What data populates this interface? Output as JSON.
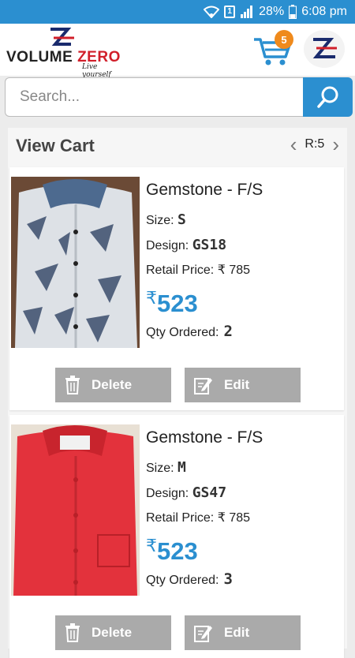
{
  "status": {
    "battery": "28%",
    "time": "6:08 pm",
    "sim": "1"
  },
  "header": {
    "logo_text_a": "VOLUME ",
    "logo_text_z": "ZERO",
    "tagline": "Live yourself",
    "cart_count": "5"
  },
  "search": {
    "placeholder": "Search..."
  },
  "cart": {
    "title": "View Cart",
    "record_label": "R:5",
    "items": [
      {
        "name": "Gemstone - F/S",
        "size_label": "Size:",
        "size": "S",
        "design_label": "Design:",
        "design": "GS18",
        "retail_label": "Retail Price:",
        "retail": "₹ 785",
        "currency": "₹",
        "price": "523",
        "qty_label": "Qty Ordered:",
        "qty": "2",
        "delete_label": "Delete",
        "edit_label": "Edit",
        "color": "#d9dde2"
      },
      {
        "name": "Gemstone - F/S",
        "size_label": "Size:",
        "size": "M",
        "design_label": "Design:",
        "design": "GS47",
        "retail_label": "Retail Price:",
        "retail": "₹ 785",
        "currency": "₹",
        "price": "523",
        "qty_label": "Qty Ordered:",
        "qty": "3",
        "delete_label": "Delete",
        "edit_label": "Edit",
        "color": "#e3323c"
      }
    ]
  }
}
